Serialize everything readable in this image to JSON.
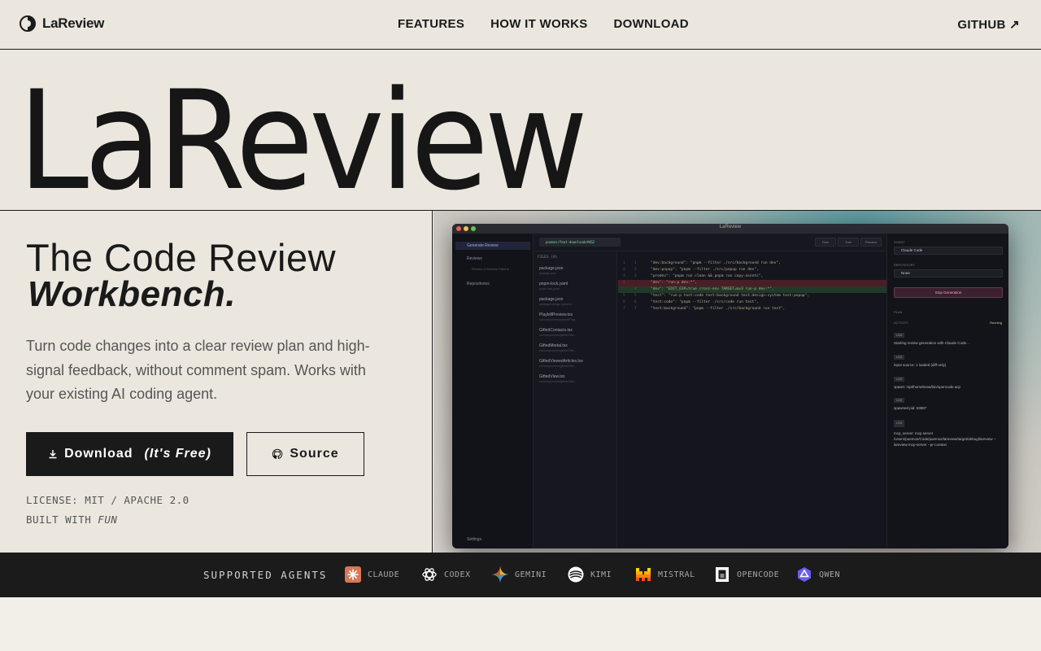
{
  "nav": {
    "brand": "LaReview",
    "links": [
      "FEATURES",
      "HOW IT WORKS",
      "DOWNLOAD"
    ],
    "github": "GITHUB ↗"
  },
  "hero": {
    "title": "LaReview",
    "tagline_line1": "The Code Review",
    "tagline_line2": "Workbench.",
    "description": "Turn code changes into a clear review plan and high-signal feedback, without comment spam. Works with your existing AI coding agent.",
    "download_label": "Download",
    "download_free": "(It's Free)",
    "source_label": "Source",
    "license": "LICENSE: MIT / APACHE 2.0",
    "built_with_prefix": "BUILT WITH",
    "built_with_word": "FUN"
  },
  "app_preview": {
    "window_title": "LaReview",
    "sidebar": {
      "items": [
        "Generate Review",
        "Reviews",
        "Review of Diverse Patche...",
        "Repositories",
        "Settings"
      ]
    },
    "branch": "puemos/feat-downloads#462",
    "toolbar": [
      "Files",
      "Tree",
      "Preview"
    ],
    "files_header": "FILES (9)",
    "files": [
      {
        "name": "package.json",
        "sub": "package.json"
      },
      {
        "name": "pnpm-lock.yaml",
        "sub": "pnpm-lock.yaml"
      },
      {
        "name": "package.json",
        "sub": "packages/design-system/..."
      },
      {
        "name": "PlaybillPreview.tsx",
        "sub": "src/components/playbill/Play..."
      },
      {
        "name": "GiftedContacts.tsx",
        "sub": "src/components/gifted/Gifte..."
      },
      {
        "name": "GiftedModal.tsx",
        "sub": "src/components/gifted/Gifte..."
      },
      {
        "name": "GiftedViewedArticles.tsx",
        "sub": "src/components/gifted/Gifte..."
      },
      {
        "name": "GiftedView.tsx",
        "sub": "src/components/gifted/Gifte..."
      }
    ],
    "code_lines": [
      {
        "n1": "1",
        "n2": "1",
        "text": "\"dev:background\": \"pnpm --filter ./src/background run dev\",",
        "kind": "ctx"
      },
      {
        "n1": "2",
        "n2": "2",
        "text": "\"dev:popup\": \"pnpm --filter ./src/popup run dev\",",
        "kind": "ctx"
      },
      {
        "n1": "3",
        "n2": "3",
        "text": "\"predev\": \"pnpm run clean && pnpm run copy-assets\",",
        "kind": "ctx"
      },
      {
        "n1": "4",
        "n2": "",
        "text": "\"dev\": \"run-p dev:*\",",
        "kind": "del"
      },
      {
        "n1": "",
        "n2": "4",
        "text": "\"dev\": \"EDIT_EXP=true cross-env TARGET=mv3 run-p dev:*\",",
        "kind": "add"
      },
      {
        "n1": "5",
        "n2": "5",
        "text": "\"test\": \"run-p test:code test:background test:design-system test:popup\",",
        "kind": "ctx"
      },
      {
        "n1": "6",
        "n2": "6",
        "text": "\"test:code\": \"pnpm --filter ./src/code run test\",",
        "kind": "ctx"
      },
      {
        "n1": "7",
        "n2": "7",
        "text": "\"test:background\": \"pnpm --filter ./src/background run test\",",
        "kind": "ctx"
      }
    ],
    "right_panel": {
      "agent_label": "AGENT",
      "agent_value": "Claude Code",
      "repository_label": "REPOSITORY",
      "repository_value": "None",
      "stop_label": "Stop Generation",
      "plan_label": "PLAN",
      "activity_label": "ACTIVITY",
      "activity_status": "Running",
      "logs": [
        {
          "tag": "LOG",
          "text": "Starting review generation with Claude Code..."
        },
        {
          "tag": "LOG",
          "text": "input source: 1 loaded (diff-only)"
        },
        {
          "tag": "LOG",
          "text": "spawn: /opt/homebrew/bin/opencode acp"
        },
        {
          "tag": "LOG",
          "text": "spawned pid: 63887"
        },
        {
          "tag": "LOG",
          "text": "mcp_server: mcp server /Users/puemos/Code/puemos/lareview/target/debug/lareview --lareview-mcp-server --pr-context"
        }
      ]
    }
  },
  "agents": {
    "label": "SUPPORTED AGENTS",
    "items": [
      {
        "name": "CLAUDE",
        "icon": "claude-icon",
        "color": "#d97757"
      },
      {
        "name": "CODEX",
        "icon": "codex-icon",
        "color": "#ffffff"
      },
      {
        "name": "GEMINI",
        "icon": "gemini-icon",
        "color": "#4a8df5"
      },
      {
        "name": "KIMI",
        "icon": "kimi-icon",
        "color": "#ffffff"
      },
      {
        "name": "MISTRAL",
        "icon": "mistral-icon",
        "color": "#fa5310"
      },
      {
        "name": "OPENCODE",
        "icon": "opencode-icon",
        "color": "#ffffff"
      },
      {
        "name": "QWEN",
        "icon": "qwen-icon",
        "color": "#6b5cf5"
      }
    ]
  }
}
